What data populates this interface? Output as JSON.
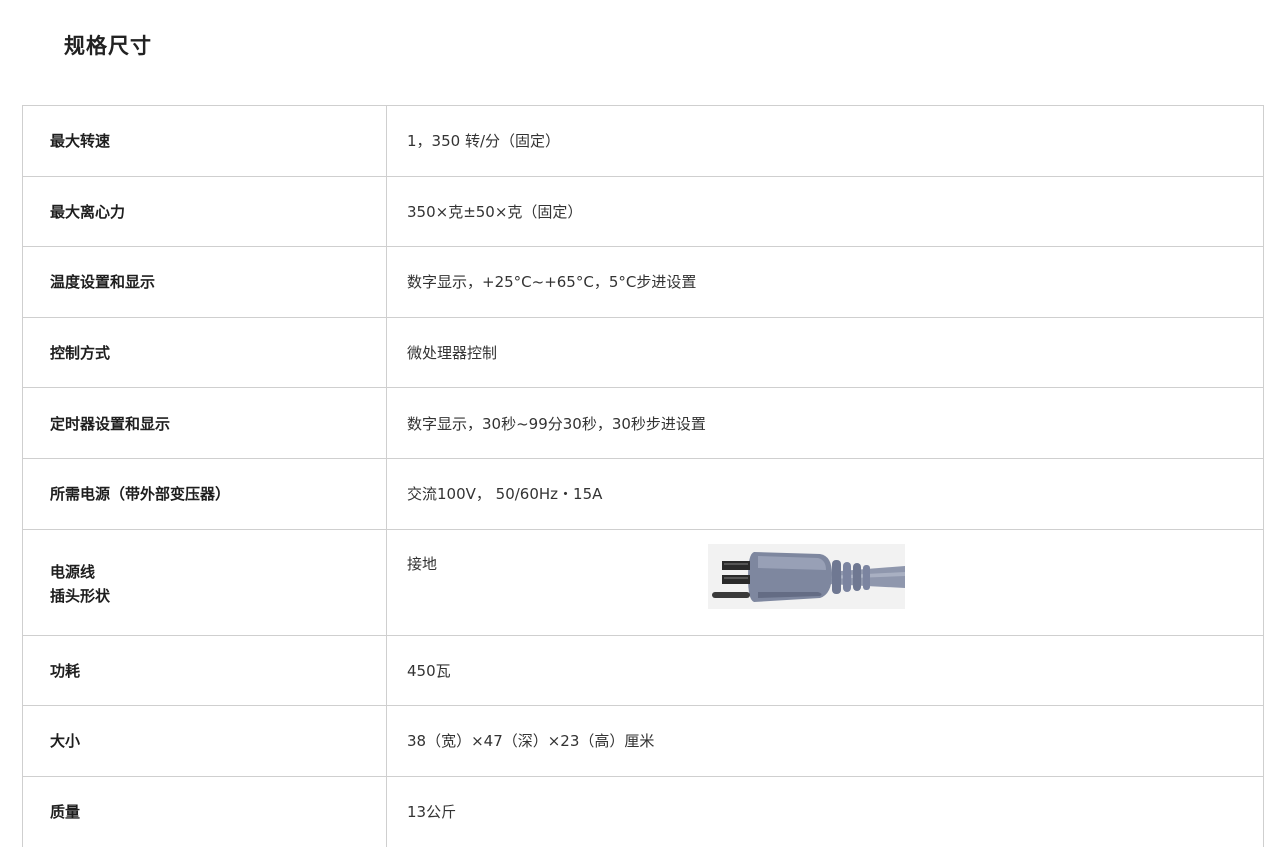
{
  "title": "规格尺寸",
  "rows": [
    {
      "label": "最大转速",
      "value": "1，350 转/分（固定）"
    },
    {
      "label": "最大离心力",
      "value": "350×克±50×克（固定）"
    },
    {
      "label": "温度设置和显示",
      "value": "数字显示，+25°C~+65°C，5°C步进设置"
    },
    {
      "label": "控制方式",
      "value": "微处理器控制"
    },
    {
      "label": "定时器设置和显示",
      "value": "数字显示，30秒~99分30秒，30秒步进设置"
    },
    {
      "label": "所需电源（带外部变压器）",
      "value": "交流100V， 50/60Hz・15A"
    },
    {
      "label_line1": "电源线",
      "label_line2": "插头形状",
      "value": "接地",
      "image_icon": "grounded-plug-image"
    },
    {
      "label": "功耗",
      "value": "450瓦"
    },
    {
      "label": "大小",
      "value": "38（宽）×47（深）×23（高）厘米"
    },
    {
      "label": "质量",
      "value": "13公斤"
    }
  ]
}
